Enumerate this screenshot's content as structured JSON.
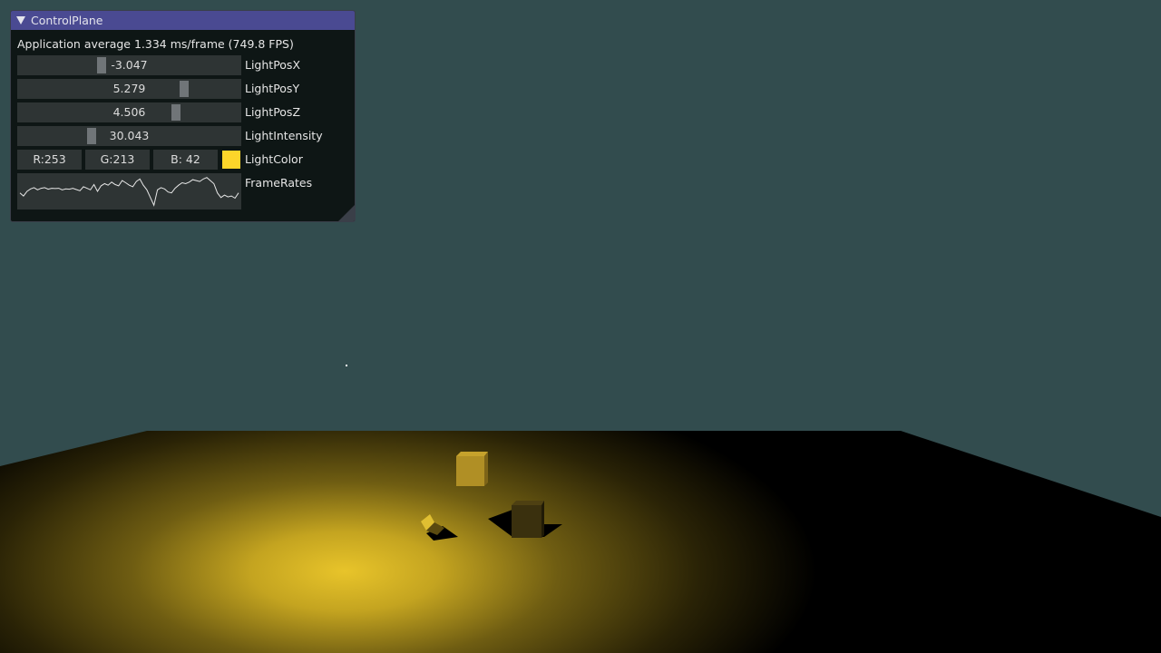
{
  "window": {
    "title": "ControlPlane",
    "fps_text": "Application average 1.334 ms/frame (749.8 FPS)"
  },
  "sliders": [
    {
      "label": "LightPosX",
      "value": "-3.047",
      "level": 0.37
    },
    {
      "label": "LightPosY",
      "value": "5.279",
      "level": 0.76
    },
    {
      "label": "LightPosZ",
      "value": "4.506",
      "level": 0.72
    },
    {
      "label": "LightIntensity",
      "value": "30.043",
      "level": 0.32
    }
  ],
  "light_color": {
    "label": "LightColor",
    "r": "R:253",
    "g": "G:213",
    "b": "B: 42",
    "swatch_color": "#fdd52a"
  },
  "plot": {
    "label": "FrameRates",
    "values": [
      0.45,
      0.35,
      0.5,
      0.58,
      0.62,
      0.55,
      0.6,
      0.62,
      0.57,
      0.6,
      0.59,
      0.6,
      0.55,
      0.58,
      0.57,
      0.6,
      0.56,
      0.52,
      0.65,
      0.6,
      0.55,
      0.72,
      0.5,
      0.68,
      0.75,
      0.7,
      0.8,
      0.72,
      0.68,
      0.85,
      0.78,
      0.7,
      0.65,
      0.82,
      0.9,
      0.7,
      0.55,
      0.3,
      0.05,
      0.55,
      0.62,
      0.58,
      0.48,
      0.45,
      0.6,
      0.7,
      0.78,
      0.75,
      0.8,
      0.88,
      0.85,
      0.82,
      0.9,
      0.95,
      0.85,
      0.75,
      0.45,
      0.3,
      0.38,
      0.32,
      0.35,
      0.28,
      0.45
    ]
  },
  "colors": {
    "background": "#324c4e",
    "title_bar": "#4a4a92",
    "light": "#fdd52a"
  }
}
